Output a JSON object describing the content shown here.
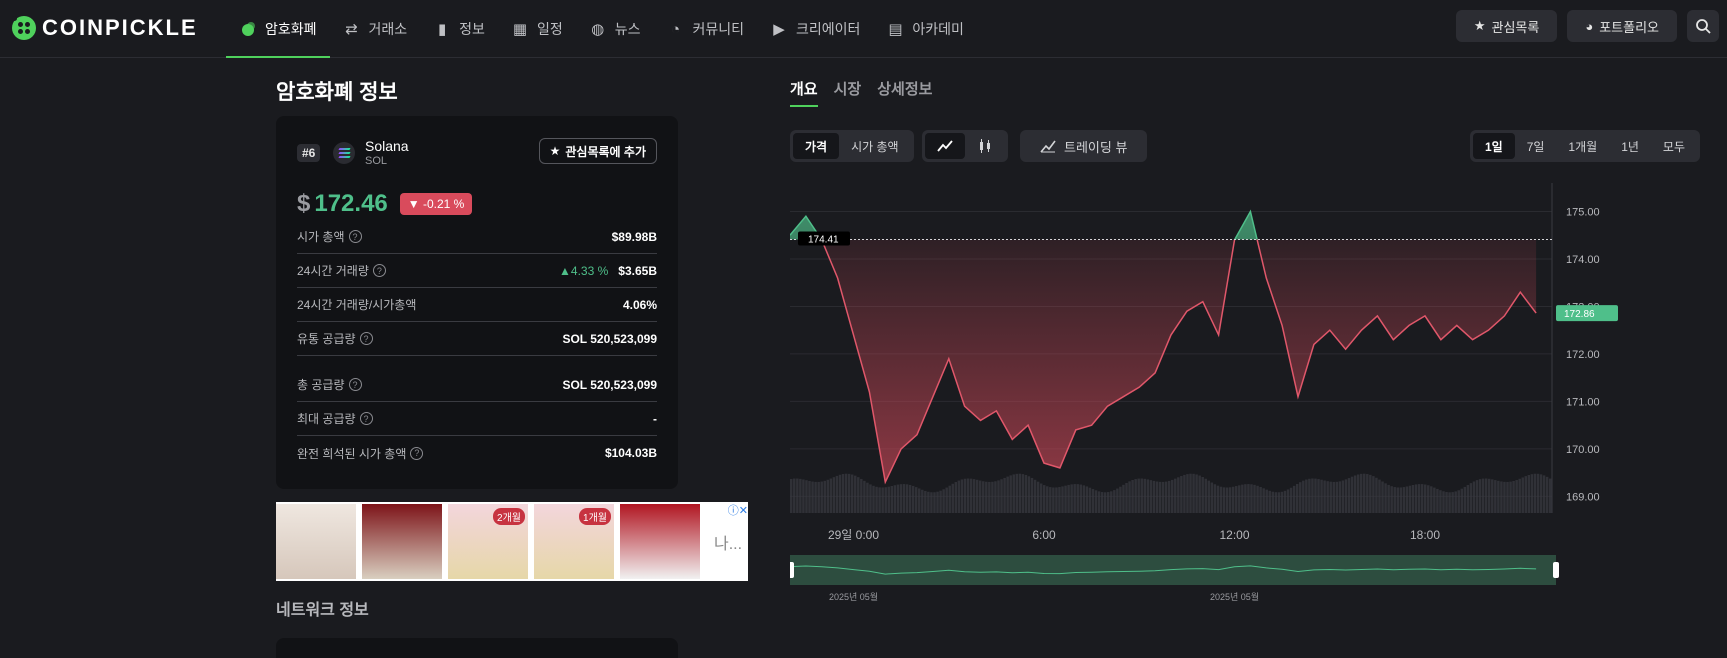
{
  "header": {
    "logo_text": "COINPICKLE",
    "nav": [
      {
        "label": "암호화폐",
        "icon": "coin-icon",
        "active": true
      },
      {
        "label": "거래소",
        "icon": "exchange-icon"
      },
      {
        "label": "정보",
        "icon": "bar-chart-icon"
      },
      {
        "label": "일정",
        "icon": "calendar-icon"
      },
      {
        "label": "뉴스",
        "icon": "globe-icon"
      },
      {
        "label": "커뮤니티",
        "icon": "chat-icon"
      },
      {
        "label": "크리에이터",
        "icon": "play-icon"
      },
      {
        "label": "아카데미",
        "icon": "book-icon"
      }
    ],
    "watchlist_label": "관심목록",
    "portfolio_label": "포트폴리오"
  },
  "page": {
    "title": "암호화폐 정보",
    "network_title": "네트워크 정보"
  },
  "coin": {
    "rank": "#6",
    "name": "Solana",
    "symbol": "SOL",
    "watch_button": "관심목록에 추가",
    "currency_symbol": "$",
    "price": "172.46",
    "change": "-0.21 %",
    "change_arrow": "▼"
  },
  "stats": [
    {
      "label": "시가 총액",
      "help": true,
      "value": "$89.98B"
    },
    {
      "label": "24시간 거래량",
      "help": true,
      "value": "$3.65B",
      "delta": "▲4.33 %"
    },
    {
      "label": "24시간 거래량/시가총액",
      "help": false,
      "value": "4.06%"
    },
    {
      "label": "유통 공급량",
      "help": true,
      "value": "SOL 520,523,099"
    },
    {
      "label": "총 공급량",
      "help": true,
      "value": "SOL 520,523,099"
    },
    {
      "label": "최대 공급량",
      "help": true,
      "value": "-"
    },
    {
      "label": "완전 희석된 시가 총액",
      "help": true,
      "value": "$104.03B"
    }
  ],
  "ad": {
    "badge_1": "2개월",
    "badge_2": "1개월",
    "more_text": "나..."
  },
  "chart_tabs": [
    "개요",
    "시장",
    "상세정보"
  ],
  "toolbar": {
    "metric": [
      "가격",
      "시가 총액"
    ],
    "trading_view": "트레이딩 뷰",
    "ranges": [
      "1일",
      "7일",
      "1개월",
      "1년",
      "모두"
    ]
  },
  "colors": {
    "accent": "#4fd15c",
    "up": "#4fbf8a",
    "down": "#d94b5c"
  },
  "chart_data": {
    "type": "area",
    "x_ticks": [
      "29일 0:00",
      "6:00",
      "12:00",
      "18:00"
    ],
    "y_ticks": [
      "175.00",
      "174.00",
      "173.00",
      "172.00",
      "171.00",
      "170.00",
      "169.00"
    ],
    "ylim": [
      168.65,
      175.6
    ],
    "baseline": 174.41,
    "baseline_label": "174.41",
    "last_label": "172.86",
    "nav_labels": [
      "2025년 05월",
      "2025년 05월"
    ],
    "x_hours_from_start": [
      0,
      0.5,
      1,
      1.5,
      2,
      2.5,
      3,
      3.5,
      4,
      4.5,
      5,
      5.5,
      6,
      6.5,
      7,
      7.5,
      8,
      8.5,
      9,
      9.5,
      10,
      10.5,
      11,
      11.5,
      12,
      12.5,
      13,
      13.5,
      14,
      14.5,
      15,
      15.5,
      16,
      16.5,
      17,
      17.5,
      18,
      18.5,
      19,
      19.5,
      20,
      20.5,
      21,
      21.5,
      22,
      22.5,
      23,
      23.5
    ],
    "values": [
      174.5,
      174.9,
      174.4,
      173.6,
      172.4,
      171.2,
      169.3,
      170.0,
      170.3,
      171.1,
      171.9,
      170.9,
      170.6,
      170.8,
      170.2,
      170.5,
      169.7,
      169.6,
      170.4,
      170.5,
      170.9,
      171.1,
      171.3,
      171.6,
      172.4,
      172.9,
      173.1,
      172.4,
      174.4,
      175.0,
      173.6,
      172.6,
      171.1,
      172.2,
      172.5,
      172.1,
      172.5,
      172.8,
      172.3,
      172.6,
      172.8,
      172.3,
      172.6,
      172.3,
      172.5,
      172.8,
      173.3,
      172.86
    ]
  }
}
